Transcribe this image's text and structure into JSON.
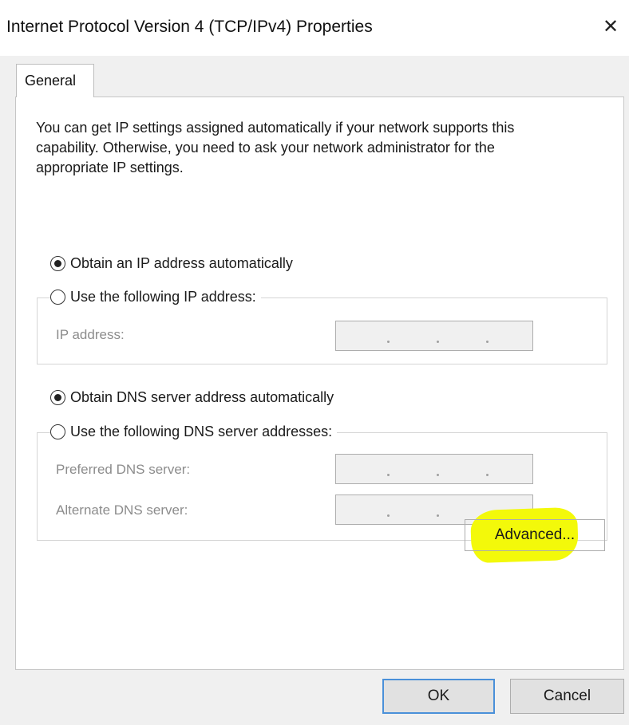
{
  "window": {
    "title": "Internet Protocol Version 4 (TCP/IPv4) Properties",
    "close_glyph": "✕"
  },
  "tabs": [
    {
      "label": "General",
      "selected": true
    }
  ],
  "intro_text": "You can get IP settings assigned automatically if your network supports this capability. Otherwise, you need to ask your network administrator for the appropriate IP settings.",
  "ip": {
    "auto_label": "Obtain an IP address automatically",
    "auto_selected": true,
    "manual_label": "Use the following IP address:",
    "manual_selected": false,
    "ip_address_label": "IP address:",
    "ip_address_value": ". . ."
  },
  "dns": {
    "auto_label": "Obtain DNS server address automatically",
    "auto_selected": true,
    "manual_label": "Use the following DNS server addresses:",
    "manual_selected": false,
    "preferred_label": "Preferred DNS server:",
    "alternate_label": "Alternate DNS server:"
  },
  "buttons": {
    "advanced": "Advanced...",
    "ok": "OK",
    "cancel": "Cancel"
  },
  "colors": {
    "highlight": "#f3f90a",
    "default_button_border": "#4a90d9",
    "dialog_bg": "#f0f0f0",
    "disabled_text": "#8c8c8c"
  }
}
